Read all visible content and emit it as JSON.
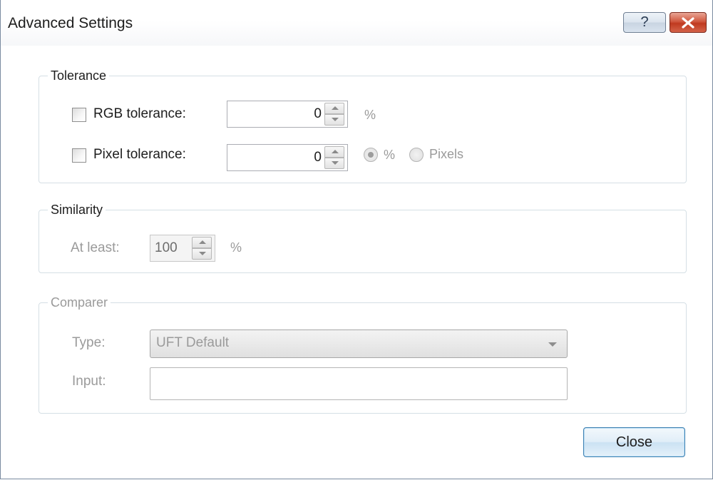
{
  "window": {
    "title": "Advanced Settings",
    "help_label": "?",
    "close_icon": "close-x-icon"
  },
  "tolerance": {
    "legend": "Tolerance",
    "rgb": {
      "label": "RGB tolerance:",
      "checked": false,
      "value": "0",
      "unit": "%"
    },
    "pixel": {
      "label": "Pixel tolerance:",
      "checked": false,
      "value": "0",
      "radio_percent_label": "%",
      "radio_pixels_label": "Pixels",
      "selected_unit": "%"
    }
  },
  "similarity": {
    "legend": "Similarity",
    "at_least_label": "At least:",
    "value": "100",
    "unit": "%"
  },
  "comparer": {
    "legend": "Comparer",
    "type_label": "Type:",
    "type_value": "UFT Default",
    "input_label": "Input:",
    "input_value": ""
  },
  "footer": {
    "close_label": "Close"
  },
  "colors": {
    "accent_border": "#3c7fb1",
    "close_red": "#c03a20"
  }
}
